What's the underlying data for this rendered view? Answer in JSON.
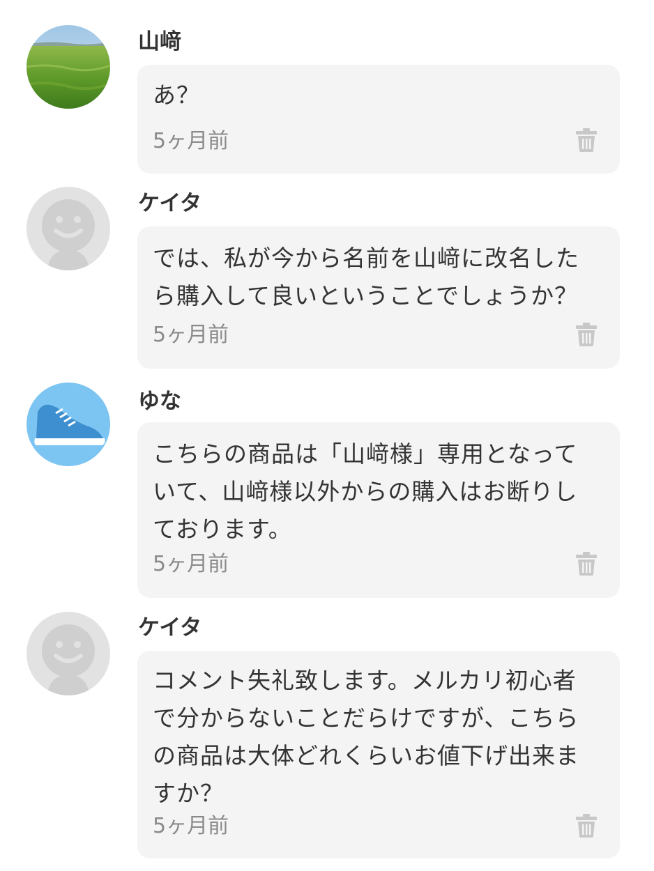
{
  "comments": [
    {
      "user": "山﨑",
      "avatar": "grass-field-photo",
      "text": "あ？",
      "time": "5ヶ月前",
      "delete_icon": "trash-icon"
    },
    {
      "user": "ケイタ",
      "avatar": "default-face-avatar",
      "text": "では、私が今から名前を山﨑に改名した\nら購入して良いということでしょうか？",
      "time": "5ヶ月前",
      "delete_icon": "trash-icon"
    },
    {
      "user": "ゆな",
      "avatar": "sneaker-avatar",
      "text": "こちらの商品は「山﨑様」専用となって\nいて、山﨑様以外からの購入はお断りし\nております。",
      "time": "5ヶ月前",
      "delete_icon": "trash-icon"
    },
    {
      "user": "ケイタ",
      "avatar": "default-face-avatar",
      "text": "コメント失礼致します。メルカリ初心者\nで分からないことだらけですが、こちら\nの商品は大体どれくらいお値下げ出来ま\nすか？",
      "time": "5ヶ月前",
      "delete_icon": "trash-icon"
    }
  ],
  "colors": {
    "bubble_bg": "#f4f4f4",
    "text": "#333333",
    "timestamp": "#8a8a8a",
    "icon": "#c8c8c8",
    "avatar_default_bg": "#e2e2e2",
    "avatar_sneaker_bg": "#7cc4f2"
  }
}
